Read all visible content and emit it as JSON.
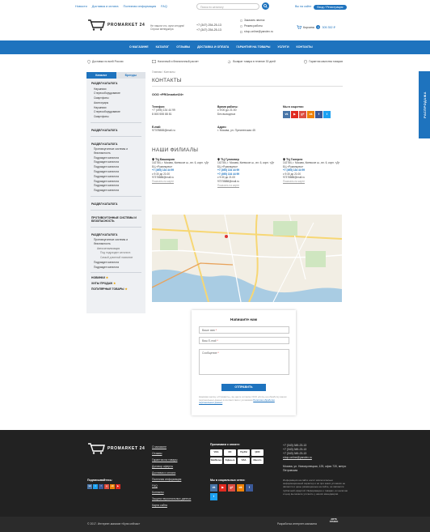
{
  "topbar": {
    "links": [
      "Новости",
      "Доставка и оплата",
      "Полезная информация",
      "FAQ"
    ],
    "search_placeholder": "Поиск по каталогу",
    "cabinet": "Вы на сайте",
    "login_register": "Вход / Регистрация"
  },
  "header": {
    "logo_text": "PROMARKET 24",
    "tagline": "Не нашли что, купи сегодня! Спроси менеджера",
    "phones": [
      "+7 (347) 254-25-13",
      "+7 (347) 254-25-13"
    ],
    "contact_items": [
      "Заказать звонок",
      "Режим работы",
      "shop-online@yandex.ru"
    ],
    "cart_label": "Корзина",
    "cart_count": "0",
    "cart_sum": "305 352 ₽"
  },
  "nav": {
    "items": [
      "О МАГАЗИНЕ",
      "КАТАЛОГ",
      "ОТЗЫВЫ",
      "ДОСТАВКА И ОПЛАТА",
      "ГАРАНТИЯ НА ТОВАРЫ",
      "УСЛУГИ",
      "КОНТАКТЫ"
    ]
  },
  "features": [
    "Доставка по всей России",
    "Наличный и безналичный расчет",
    "Возврат товара в течение 30 дней",
    "Гарантия качества товаров"
  ],
  "sidebar": {
    "tabs": [
      "Каталог",
      "Бренды"
    ],
    "sections": [
      {
        "title": "РАЗДЕЛ КАТАЛОГА",
        "items": [
          "Наушники",
          "Стереооборудование",
          "Смартфоны",
          "Аксессуары",
          "Наушники",
          "Стереооборудование",
          "Смартфоны"
        ]
      },
      {
        "title": "РАЗДЕЛ КАТАЛОГА",
        "items": []
      },
      {
        "title": "РАЗДЕЛ КАТАЛОГА",
        "items": [
          "Противоугонные системы и безопасность",
          "Подраздел каталога",
          "Подраздел каталога",
          "Подраздел каталога",
          "Подраздел каталога",
          "Подраздел каталога",
          "Подраздел каталога",
          "Подраздел каталога",
          "Подраздел каталога"
        ]
      },
      {
        "title": "РАЗДЕЛ КАТАЛОГА",
        "items": []
      },
      {
        "title": "ПРОТИВОУГОННЫЕ СИСТЕМЫ И БЕЗОПАСНОСТЬ",
        "items": []
      },
      {
        "title": "РАЗДЕЛ КАТАЛОГА",
        "items": [
          "Противоугонные системы и безопасность",
          "Автосигнализация",
          "Под подраздел каталога",
          "Самый длинный название",
          "Подраздел каталога",
          "Подраздел каталога"
        ]
      }
    ],
    "specials": [
      "НОВИНКИ",
      "ХИТЫ ПРОДАЖ",
      "ПОПУЛЯРНЫЕ ТОВАРЫ"
    ]
  },
  "main": {
    "breadcrumbs": "Главная / Контакты",
    "title": "КОНТАКТЫ",
    "company": "ООО «PROmarket24»",
    "phone_label": "Телефон:",
    "phone_lines": [
      "+7 (495) 134 44 99",
      "8 800 555 88 81"
    ],
    "hours_label": "Время работы:",
    "hours_lines": [
      "с 9:00 до 21:00",
      "Без выходных"
    ],
    "social_label": "Мы в соцсетях:",
    "email_label": "E-mail:",
    "email_value": "97378888@mail.ru",
    "address_label": "Адрес:",
    "address_value": "г. Москва, ул. Пресненская 45",
    "branches_title": "НАШИ ФИЛИАЛЫ",
    "branches": [
      {
        "name": "ТЦ Башкирия",
        "address": "142784, г. Москва, Киевское ш., вл. 6, корп. «Д» БЦ «Румянцево»",
        "phone": "+7 (495) 134 44 99",
        "hours": "с 9:30 до 21:00",
        "email": "97378888@mail.ru",
        "link": "Показать на карте"
      },
      {
        "name": "ТЦ Гулливер",
        "address": "142784, г. Москва, Киевское ш., вл. 6, корп. «Д» БЦ «Румянцево»",
        "phone": "+7 (495) 134 44 99",
        "phone2": "+7 (495) 134 44 99",
        "hours": "с 9:30 до 21:00",
        "email": "97378888@mail.ru",
        "link": "Показать на карте"
      },
      {
        "name": "ТЦ Галерея",
        "address": "142784, г. Москва, Киевское ш., вл. 6, корп. «Д» БЦ «Румянцево»",
        "phone": "+7 (495) 134 44 99",
        "hours": "с 9:30 до 21:00",
        "email": "97378888@mail.ru",
        "link": "Показать на карте"
      }
    ]
  },
  "form": {
    "title": "Напишите нам",
    "name_placeholder": "Ваше имя",
    "email_placeholder": "Ваш E-mail",
    "message_placeholder": "Сообщение",
    "submit": "ОТПРАВИТЬ",
    "note": "Нажимая кнопку «Отправить», вы даете согласие ООО «Котэ» на обработку ваших персональных данных в соответствии с условиями",
    "note_link": "Политики обработки персональных данных"
  },
  "side_tab": "РАСПРОДАЖА",
  "footer": {
    "logo_text": "PROMARKET 24",
    "links": [
      "О магазине",
      "Отзывы",
      "Гарантия на товары",
      "Договор оферты",
      "Доставка и оплата",
      "Полезная информация",
      "FAQ",
      "Контакты",
      "Защита персональных данных",
      "Карта сайта"
    ],
    "pay_title": "Принимаем к оплате:",
    "pay_methods": [
      "VISA",
      "MC",
      "PayPal",
      "QIWI",
      "WebMoney",
      "Я.Деньги",
      "VISA",
      "Maestro"
    ],
    "social_title_left": "Подписывайтесь:",
    "social_title_right": "Мы в социальных сетях:",
    "phones": [
      "+7 (343) 345-23-13",
      "+7 (343) 345-23-13",
      "+7 (343) 345-23-13"
    ],
    "email": "shop-online@yandex.ru",
    "address": "Москва, ул. Новокузнецкая, 125, офис 720, метро Петровская",
    "disclaimer": "Информация на сайте носит исключительно информационный характер и ни при каких условиях не является и цены размещенные на сайте, не являются публичной офертой. Информацию о товарах, их наличии и цену вы можете уточнить у наших менеджеров.",
    "copyright": "© 2017. Интернет-магазин «Купи сейчас»",
    "developer": "Разработка интернет-магазина",
    "developer_logo": "ARTS STUDIO"
  },
  "colors": {
    "accent": "#1e73be",
    "footer": "#222222"
  }
}
